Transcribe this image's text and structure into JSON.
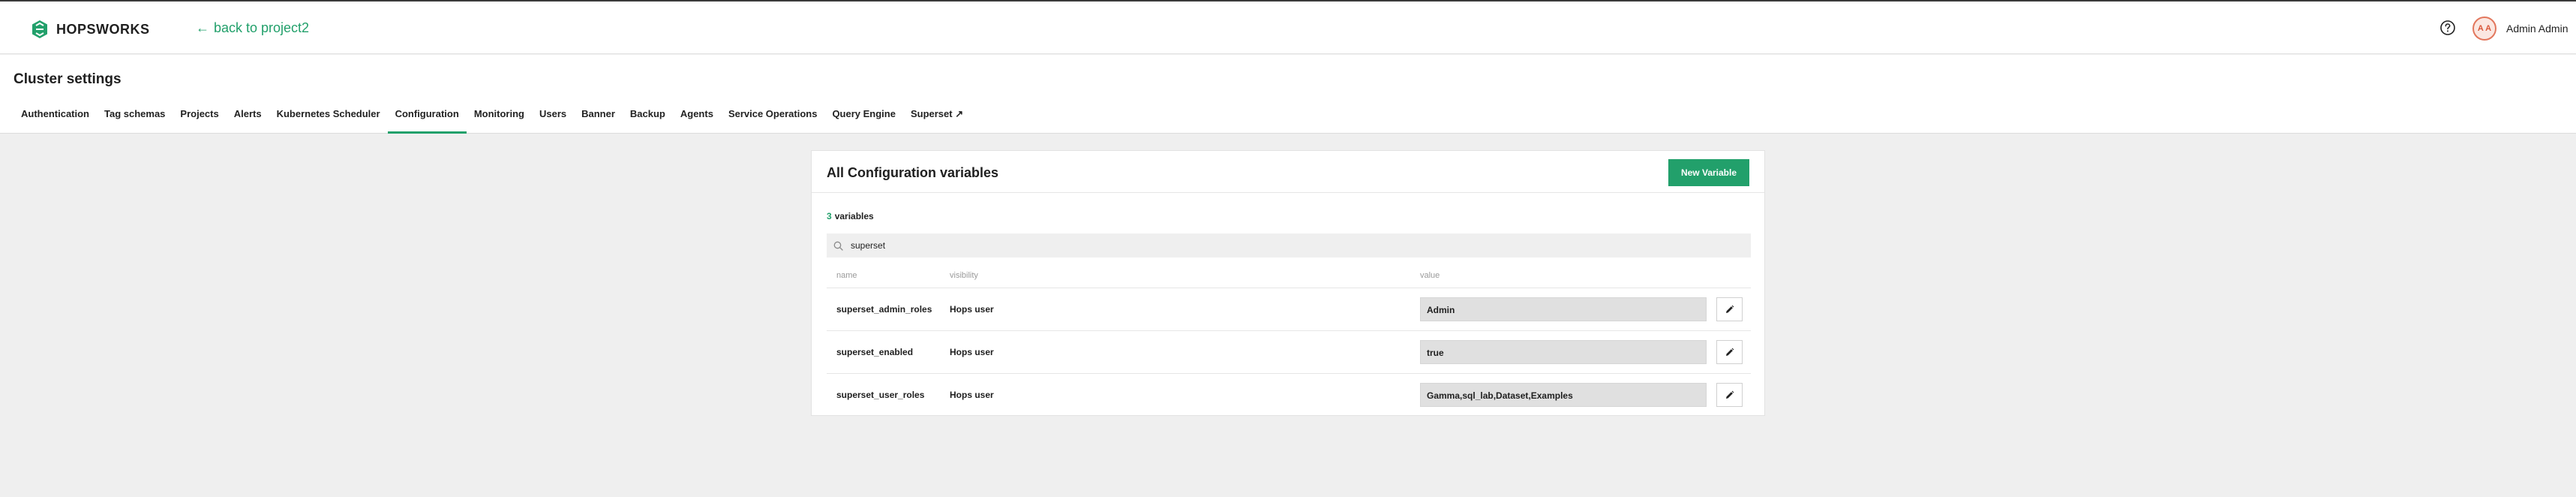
{
  "app": {
    "brand": "HOPSWORKS",
    "back_link": "back to project2",
    "back_arrow": "←",
    "accent_color": "#22a06b"
  },
  "user": {
    "initials": "A A",
    "name": "Admin Admin"
  },
  "page": {
    "title": "Cluster settings"
  },
  "tabs": [
    {
      "label": "Authentication",
      "active": false
    },
    {
      "label": "Tag schemas",
      "active": false
    },
    {
      "label": "Projects",
      "active": false
    },
    {
      "label": "Alerts",
      "active": false
    },
    {
      "label": "Kubernetes Scheduler",
      "active": false
    },
    {
      "label": "Configuration",
      "active": true
    },
    {
      "label": "Monitoring",
      "active": false
    },
    {
      "label": "Users",
      "active": false
    },
    {
      "label": "Banner",
      "active": false
    },
    {
      "label": "Backup",
      "active": false
    },
    {
      "label": "Agents",
      "active": false
    },
    {
      "label": "Service Operations",
      "active": false
    },
    {
      "label": "Query Engine",
      "active": false
    },
    {
      "label": "Superset ↗",
      "active": false
    }
  ],
  "card": {
    "title": "All Configuration variables",
    "new_button": "New Variable",
    "count": "3",
    "count_suffix": "variables",
    "search_value": "superset",
    "columns": {
      "name": "name",
      "visibility": "visibility",
      "value": "value"
    },
    "rows": [
      {
        "name": "superset_admin_roles",
        "visibility": "Hops user",
        "value": "Admin"
      },
      {
        "name": "superset_enabled",
        "visibility": "Hops user",
        "value": "true"
      },
      {
        "name": "superset_user_roles",
        "visibility": "Hops user",
        "value": "Gamma,sql_lab,Dataset,Examples"
      }
    ]
  },
  "icons": {
    "logo": "hopsworks-logo-icon",
    "help": "help-circle-icon",
    "search": "search-icon",
    "edit": "pencil-icon"
  }
}
